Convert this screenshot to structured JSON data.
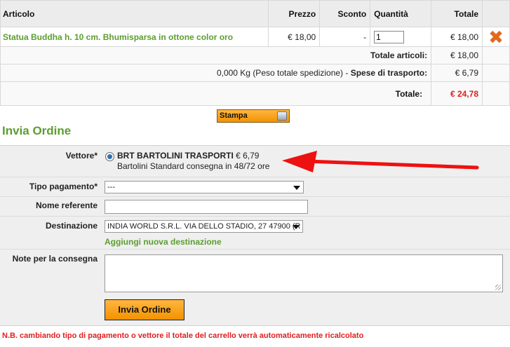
{
  "cart": {
    "headers": {
      "article": "Articolo",
      "price": "Prezzo",
      "discount": "Sconto",
      "quantity": "Quantità",
      "total": "Totale"
    },
    "item": {
      "name": "Statua Buddha h. 10 cm. Bhumisparsa in ottone color oro",
      "price": "€ 18,00",
      "discount": "-",
      "quantity": "1",
      "total": "€ 18,00",
      "remove_icon": "close-x-icon"
    },
    "total_articles_label": "Totale articoli:",
    "total_articles_value": "€ 18,00",
    "shipping_weight": "0,000 Kg (Peso totale spedizione) - ",
    "shipping_label": "Spese di trasporto:",
    "shipping_value": "€ 6,79",
    "grand_total_label": "Totale:",
    "grand_total_value": "€ 24,78"
  },
  "print_button_label": "Stampa",
  "section_title": "Invia Ordine",
  "form": {
    "carrier_label": "Vettore*",
    "carrier_name": "BRT BARTOLINI TRASPORTI",
    "carrier_price": " € 6,79",
    "carrier_desc": "Bartolini Standard consegna in 48/72 ore",
    "payment_label": "Tipo pagamento*",
    "payment_value": "---",
    "referent_label": "Nome referente",
    "referent_value": "",
    "destination_label": "Destinazione",
    "destination_value": "INDIA WORLD S.R.L. VIA DELLO STADIO, 27 47900 (R",
    "add_destination_label": "Aggiungi nuova destinazione",
    "notes_label": "Note per la consegna",
    "notes_value": "",
    "submit_label": "Invia Ordine"
  },
  "note_text": "N.B. cambiando tipo di pagamento o vettore il totale del carrello verrà automaticamente ricalcolato",
  "colors": {
    "accent_green": "#5b9e2d",
    "total_red": "#e01e1e",
    "button_orange": "#f39200",
    "annotation_arrow": "#ee1111"
  }
}
